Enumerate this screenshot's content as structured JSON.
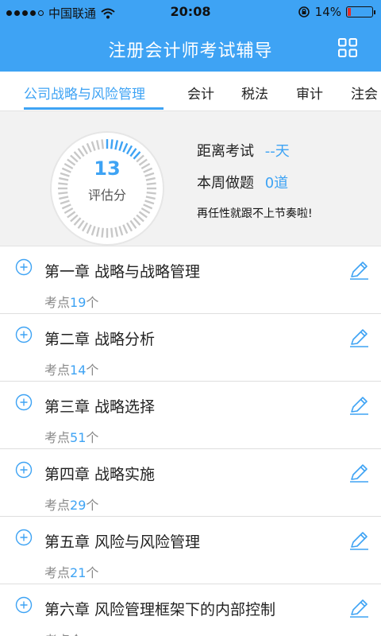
{
  "status": {
    "carrier": "中国联通",
    "time": "20:08",
    "battery": "14%",
    "battery_level": 0.14
  },
  "header": {
    "title": "注册会计师考试辅导"
  },
  "tabs": [
    {
      "label": "公司战略与风险管理"
    },
    {
      "label": "会计"
    },
    {
      "label": "税法"
    },
    {
      "label": "审计"
    },
    {
      "label": "注会"
    }
  ],
  "summary": {
    "score": "13",
    "score_label": "评估分",
    "exam_label": "距离考试",
    "exam_value": "--天",
    "week_label": "本周做题",
    "week_value": "0道",
    "slogan": "再任性就跟不上节奏啦!"
  },
  "chapters": [
    {
      "title": "第一章 战略与战略管理",
      "points_label": "考点",
      "points": "19",
      "unit": "个"
    },
    {
      "title": "第二章 战略分析",
      "points_label": "考点",
      "points": "14",
      "unit": "个"
    },
    {
      "title": "第三章 战略选择",
      "points_label": "考点",
      "points": "51",
      "unit": "个"
    },
    {
      "title": "第四章 战略实施",
      "points_label": "考点",
      "points": "29",
      "unit": "个"
    },
    {
      "title": "第五章 风险与风险管理",
      "points_label": "考点",
      "points": "21",
      "unit": "个"
    },
    {
      "title": "第六章 风险管理框架下的内部控制",
      "points_label": "考点",
      "points": "",
      "unit": "个"
    }
  ],
  "colors": {
    "accent": "#3ea3f4",
    "background": "#f2f2f2"
  }
}
